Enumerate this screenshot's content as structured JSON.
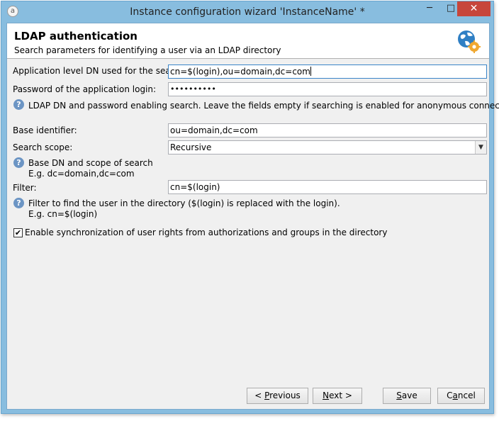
{
  "window": {
    "title": "Instance configuration wizard 'InstanceName' *",
    "minimize": "─",
    "maximize": "□",
    "close": "✕"
  },
  "header": {
    "title": "LDAP authentication",
    "subtitle": "Search parameters for identifying a user via an LDAP directory",
    "icon": "globe-gear-icon"
  },
  "form": {
    "app_dn_label": "Application level DN used for the search:",
    "app_dn_value": "cn=$(login),ou=domain,dc=com",
    "password_label": "Password of the application login:",
    "password_value": "••••••••••",
    "help1": "LDAP DN and password enabling search. Leave the fields empty if searching is enabled for anonymous connections.",
    "base_label": "Base identifier:",
    "base_value": "ou=domain,dc=com",
    "scope_label": "Search scope:",
    "scope_value": "Recursive",
    "help2_line1": "Base DN and scope of search",
    "help2_line2": "E.g. dc=domain,dc=com",
    "filter_label": "Filter:",
    "filter_value": "cn=$(login)",
    "help3_line1": "Filter to find the user in the directory ($(login) is replaced with the login).",
    "help3_line2": "E.g. cn=$(login)",
    "sync_label": "Enable synchronization of user rights from authorizations and groups in the directory",
    "sync_checked": true
  },
  "buttons": {
    "previous_prefix": "< ",
    "previous_mnemonic": "P",
    "previous_rest": "revious",
    "next_mnemonic": "N",
    "next_rest": "ext >",
    "save_mnemonic": "S",
    "save_rest": "ave",
    "cancel_prefix": "C",
    "cancel_mnemonic": "a",
    "cancel_rest": "ncel"
  }
}
